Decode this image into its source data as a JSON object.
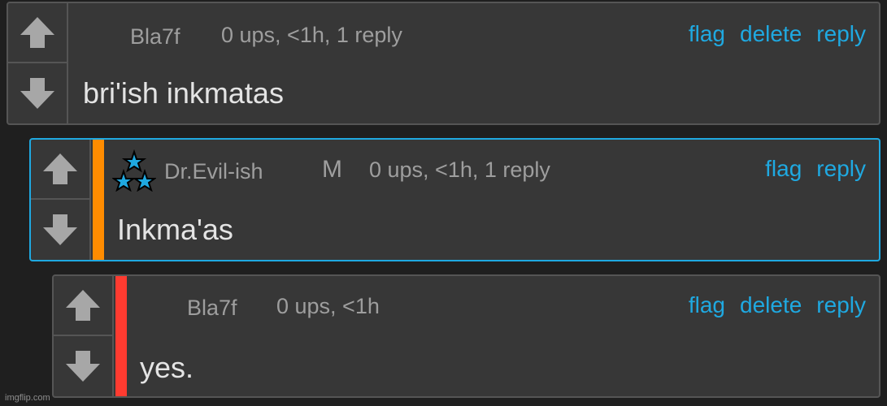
{
  "comments": [
    {
      "username": "Bla7f",
      "meta": "0 ups, <1h, 1 reply",
      "actions": {
        "flag": "flag",
        "delete": "delete",
        "reply": "reply"
      },
      "text": "bri'ish inkmatas"
    },
    {
      "username": "Dr.Evil-ish",
      "mod": "M",
      "meta": "0 ups, <1h, 1 reply",
      "actions": {
        "flag": "flag",
        "reply": "reply"
      },
      "text": "Inkma'as",
      "bar_color": "#ff8c00",
      "border_color": "#1fa9e1"
    },
    {
      "username": "Bla7f",
      "meta": "0 ups, <1h",
      "actions": {
        "flag": "flag",
        "delete": "delete",
        "reply": "reply"
      },
      "text": "yes.",
      "bar_color": "#ff3b30"
    }
  ],
  "colors": {
    "link": "#1fa9e1",
    "panel": "#373737",
    "background": "#1f1f1f"
  },
  "watermark": "imgflip.com"
}
